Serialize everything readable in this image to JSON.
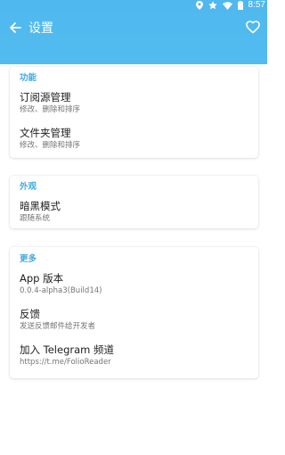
{
  "status_bar": {
    "time": "8:57",
    "icons": [
      "location-icon",
      "star-icon",
      "wifi-icon",
      "battery-icon"
    ]
  },
  "toolbar": {
    "title": "设置",
    "back_icon": "arrow-left-icon",
    "favorite_icon": "heart-outline-icon"
  },
  "colors": {
    "primary": "#4fb8ee",
    "accent": "#43a9e3",
    "primary_text": "#212121",
    "secondary_text": "#757575"
  },
  "sections": [
    {
      "title": "功能",
      "items": [
        {
          "title": "订阅源管理",
          "subtitle": "修改、删除和排序"
        },
        {
          "title": "文件夹管理",
          "subtitle": "修改、删除和排序"
        }
      ]
    },
    {
      "title": "外观",
      "items": [
        {
          "title": "暗黑模式",
          "subtitle": "跟随系统"
        }
      ]
    },
    {
      "title": "更多",
      "items": [
        {
          "title": "App 版本",
          "subtitle": "0.0.4-alpha3(Build14)"
        },
        {
          "title": "反馈",
          "subtitle": "发送反馈邮件给开发者"
        },
        {
          "title": "加入 Telegram 频道",
          "subtitle": "https://t.me/FolioReader"
        }
      ]
    }
  ]
}
